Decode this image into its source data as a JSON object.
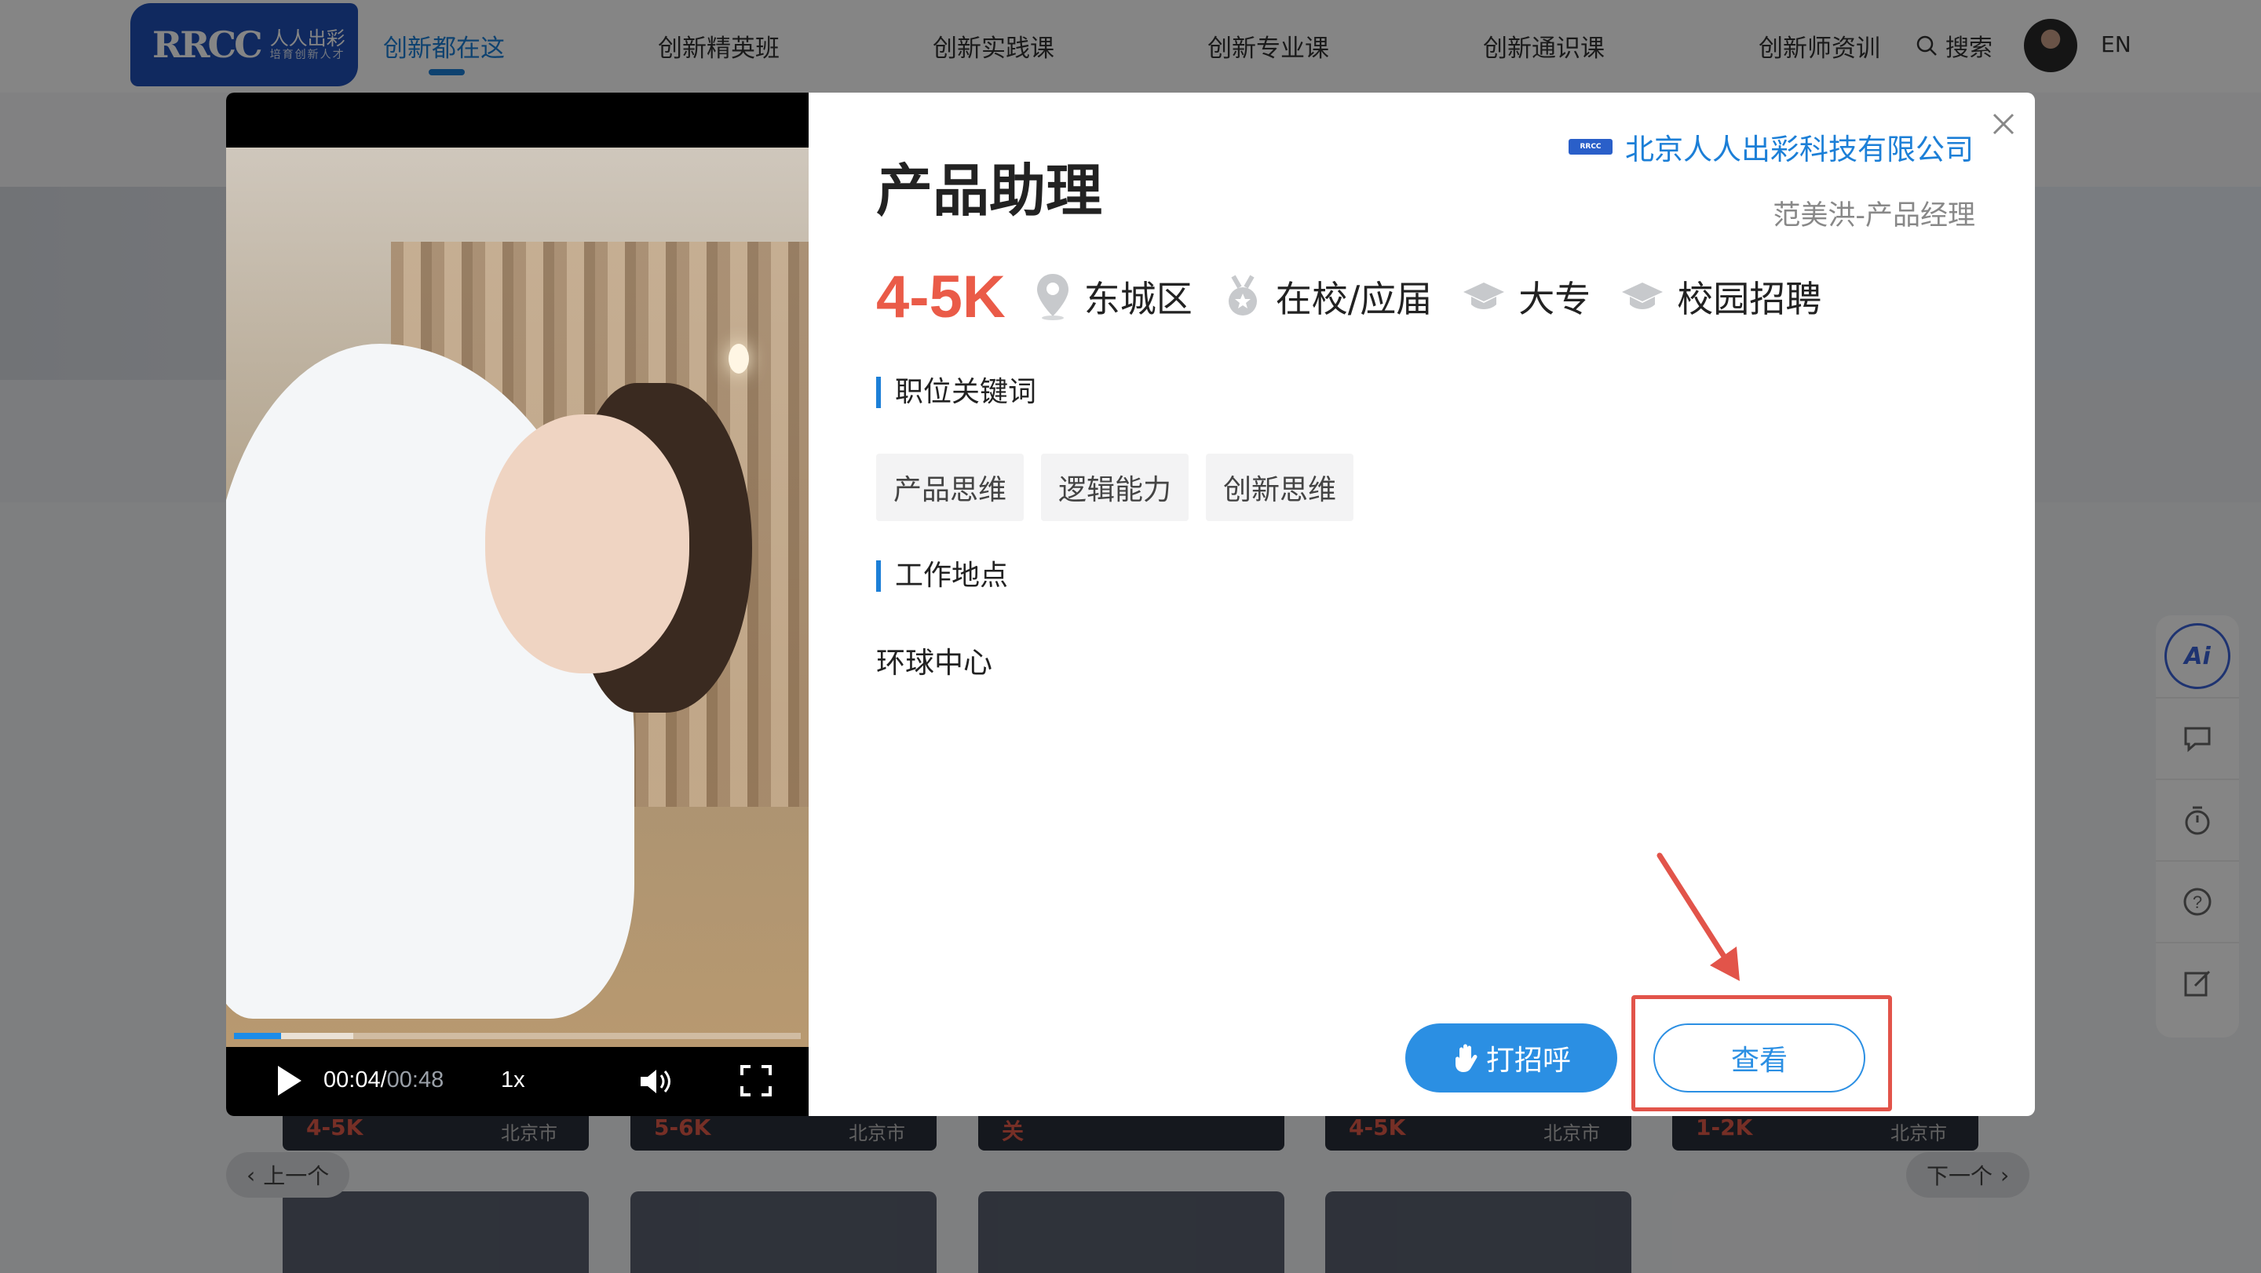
{
  "nav": {
    "logo_mark": "RRCC",
    "logo_cn": "人人出彩",
    "logo_slogan": "培育创新人才",
    "items": [
      "创新都在这",
      "创新精英班",
      "创新实践课",
      "创新专业课",
      "创新通识课",
      "创新师资训"
    ],
    "active_index": 0,
    "search_label": "搜索",
    "lang": "EN"
  },
  "background": {
    "cards": [
      {
        "salary": "4-5K",
        "city": "北京市"
      },
      {
        "salary": "5-6K",
        "city": "北京市"
      },
      {
        "salary": "关",
        "city": ""
      },
      {
        "salary": "4-5K",
        "city": "北京市"
      },
      {
        "salary": "1-2K",
        "city": "北京市"
      }
    ],
    "prev_label": "上一个",
    "next_label": "下一个"
  },
  "sidebar": {
    "ai_label": "Ai",
    "tools": [
      "chat-icon",
      "timer-icon",
      "help-icon",
      "edit-icon"
    ]
  },
  "video": {
    "current_time": "00:04",
    "duration": "00:48",
    "speed": "1x",
    "played_fraction": 0.083,
    "buffered_fraction": 0.21
  },
  "job": {
    "company": "北京人人出彩科技有限公司",
    "company_logo_text": "RRCC",
    "recruiter": "范美洪-产品经理",
    "title": "产品助理",
    "salary": "4-5K",
    "district": "东城区",
    "status": "在校/应届",
    "education": "大专",
    "type": "校园招聘",
    "keywords_label": "职位关键词",
    "keywords": [
      "产品思维",
      "逻辑能力",
      "创新思维"
    ],
    "location_label": "工作地点",
    "location": "环球中心"
  },
  "actions": {
    "greet_label": "打招呼",
    "view_label": "查看"
  },
  "colors": {
    "accent": "#2b8fe3",
    "salary": "#ea5b48",
    "annotation": "#e2544a"
  }
}
